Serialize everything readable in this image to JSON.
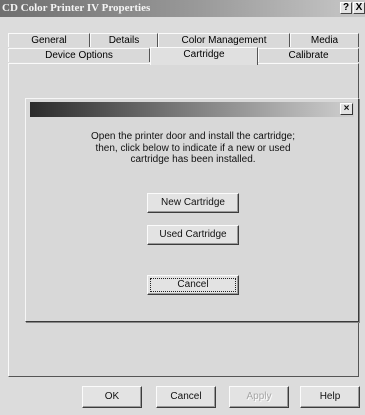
{
  "window": {
    "title": "CD Color Printer IV Properties",
    "help_glyph": "?",
    "close_glyph": "X"
  },
  "tabs_row1": [
    "General",
    "Details",
    "Color Management",
    "Media"
  ],
  "tabs_row2": [
    "Device Options",
    "Cartridge",
    "Calibrate"
  ],
  "active_tab": "Cartridge",
  "dialog": {
    "close_glyph": "×",
    "message_lines": [
      "Open the printer door and install the cartridge;",
      "then, click below to indicate if a new or used",
      "cartridge has been installed."
    ],
    "new_cartridge_label": "New Cartridge",
    "used_cartridge_label": "Used Cartridge",
    "cancel_label": "Cancel"
  },
  "footer": {
    "ok_label": "OK",
    "cancel_label": "Cancel",
    "apply_label": "Apply",
    "help_label": "Help"
  }
}
